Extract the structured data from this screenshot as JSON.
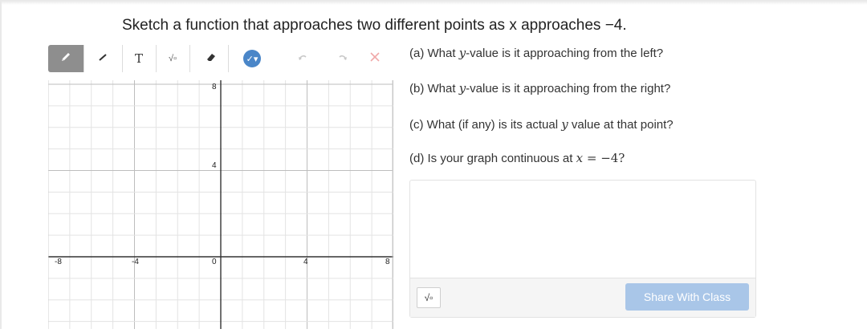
{
  "title": "Sketch a function that approaches two different points as x approaches −4.",
  "toolbar": {
    "text_tool_label": "T",
    "sqrt_tool_label": "√▫",
    "color_tool_label": "✓▾",
    "pencil_icon": "pencil-icon",
    "line_icon": "line-icon",
    "eraser_icon": "eraser-icon",
    "undo_icon": "undo-icon",
    "redo_icon": "redo-icon",
    "clear_icon": "close-icon",
    "active_color": "#4a86c8"
  },
  "graph": {
    "x_ticks": [
      "-8",
      "-4",
      "0",
      "4",
      "8"
    ],
    "y_ticks": [
      "8",
      "4"
    ]
  },
  "questions": {
    "a_prefix": "(a) What ",
    "a_var": "y",
    "a_suffix": "-value is it approaching from the left?",
    "b_prefix": "(b) What ",
    "b_var": "y",
    "b_suffix": "-value is it approaching from the right?",
    "c_prefix": "(c) What (if any) is its actual ",
    "c_var": "y",
    "c_suffix": " value at that point?",
    "d_prefix": "(d) Is your graph continuous at ",
    "d_var": "x",
    "d_math": " = −4?"
  },
  "answer": {
    "sqrt_label": "√▫",
    "share_label": "Share With Class"
  }
}
